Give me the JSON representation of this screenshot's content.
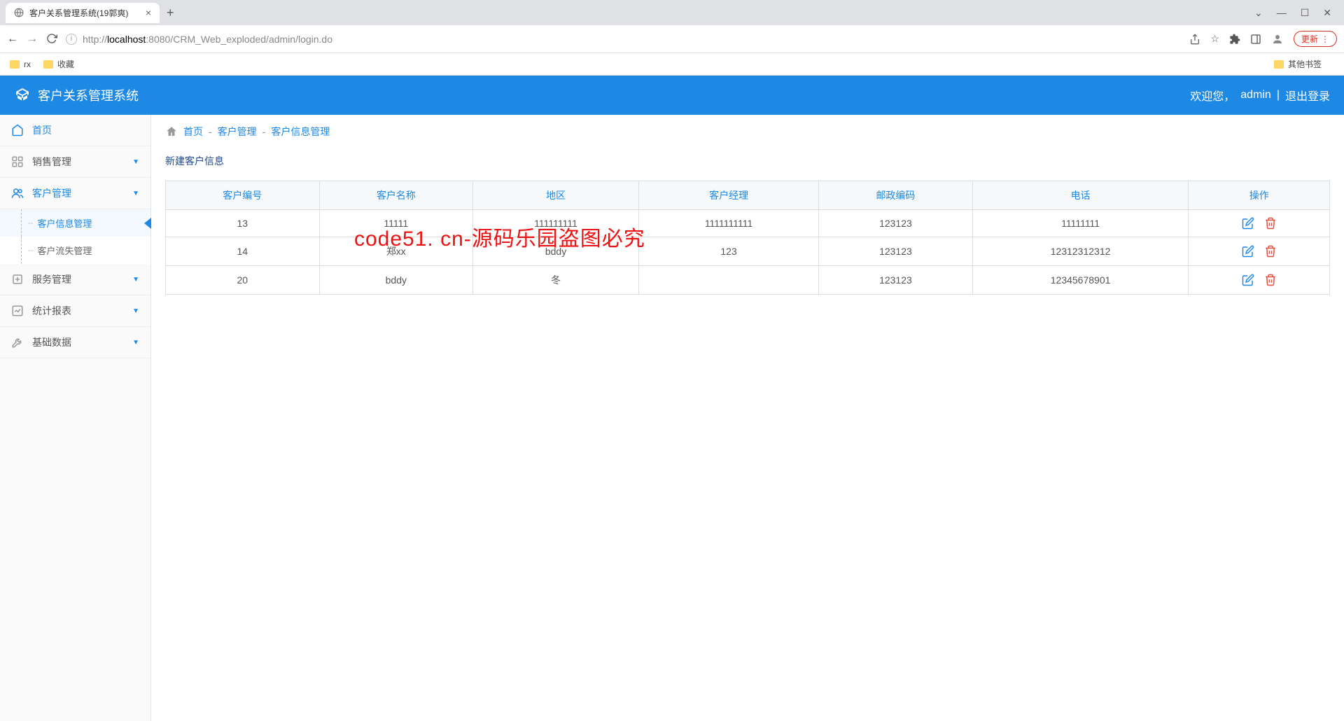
{
  "browser": {
    "tab_title": "客户关系管理系统(19郭爽)",
    "url_prefix": "http://",
    "url_host": "localhost",
    "url_port": ":8080",
    "url_path": "/CRM_Web_exploded/admin/login.do",
    "update_label": "更新",
    "bookmarks": {
      "rx": "rx",
      "fav": "收藏",
      "other": "其他书签"
    }
  },
  "header": {
    "app_title": "客户关系管理系统",
    "welcome": "欢迎您，",
    "username": "admin",
    "sep": "|",
    "logout": "退出登录"
  },
  "sidebar": {
    "home": "首页",
    "sales": "销售管理",
    "customer": "客户管理",
    "customer_info": "客户信息管理",
    "customer_loss": "客户流失管理",
    "service": "服务管理",
    "stats": "统计报表",
    "base": "基础数据"
  },
  "breadcrumb": {
    "home": "首页",
    "l1": "客户管理",
    "l2": "客户信息管理",
    "sep": "-"
  },
  "actions": {
    "new_customer": "新建客户信息"
  },
  "table": {
    "headers": [
      "客户编号",
      "客户名称",
      "地区",
      "客户经理",
      "邮政编码",
      "电话",
      "操作"
    ],
    "rows": [
      {
        "id": "13",
        "name": "11111",
        "region": "111111111",
        "manager": "1111111111",
        "postal": "123123",
        "phone": "11111111"
      },
      {
        "id": "14",
        "name": "郑xx",
        "region": "bddy",
        "manager": "123",
        "postal": "123123",
        "phone": "12312312312"
      },
      {
        "id": "20",
        "name": "bddy",
        "region": "冬",
        "manager": "",
        "postal": "123123",
        "phone": "12345678901"
      }
    ]
  },
  "watermark": "code51. cn-源码乐园盗图必究"
}
